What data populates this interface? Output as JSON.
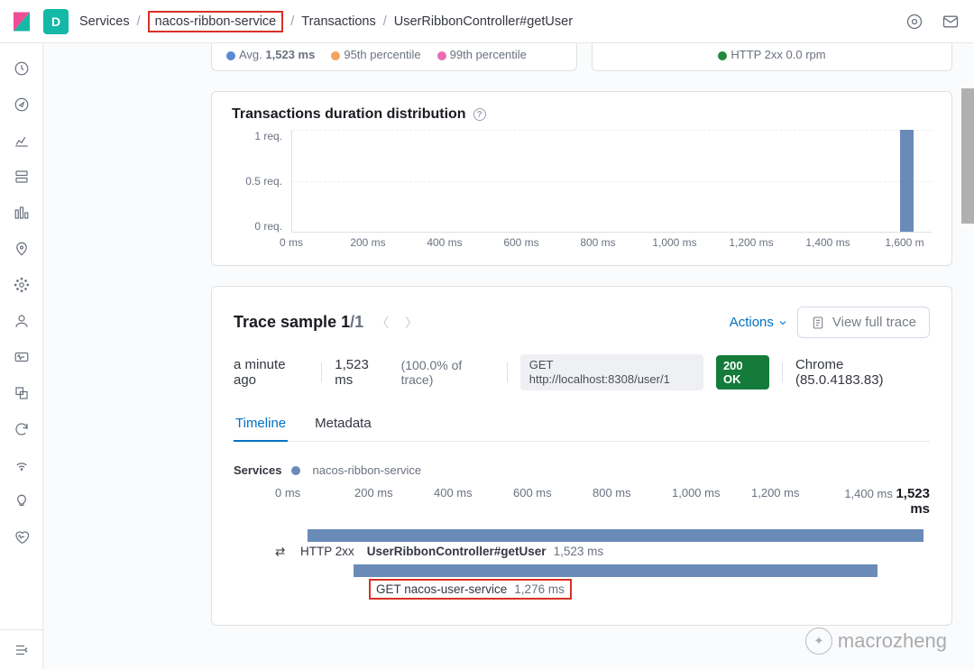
{
  "top": {
    "space_letter": "D",
    "crumbs": [
      "Services",
      "nacos-ribbon-service",
      "Transactions",
      "UserRibbonController#getUser"
    ]
  },
  "legend": {
    "avg_label": "Avg.",
    "avg_value": "1,523 ms",
    "p95": "95th percentile",
    "p99": "99th percentile",
    "http2xx": "HTTP 2xx",
    "http2xx_rate": "0.0 rpm"
  },
  "dist": {
    "title": "Transactions duration distribution",
    "y": [
      "1 req.",
      "0.5 req.",
      "0 req."
    ],
    "x": [
      "0 ms",
      "200 ms",
      "400 ms",
      "600 ms",
      "800 ms",
      "1,000 ms",
      "1,200 ms",
      "1,400 ms",
      "1,600 m"
    ]
  },
  "chart_data": {
    "type": "bar",
    "title": "Transactions duration distribution",
    "xlabel": "",
    "ylabel": "",
    "x_unit": "ms",
    "y_unit": "req.",
    "categories": [
      0,
      200,
      400,
      600,
      800,
      1000,
      1200,
      1400,
      1600
    ],
    "values_at": {
      "bucket_ms": 1523,
      "count": 1
    },
    "xlim": [
      0,
      1600
    ],
    "ylim": [
      0,
      1
    ]
  },
  "trace": {
    "title": "Trace sample",
    "index": "1",
    "total": "/1",
    "actions": "Actions",
    "view_full": "View full trace",
    "time_ago": "a minute ago",
    "duration": "1,523 ms",
    "percent": "(100.0% of trace)",
    "method": "GET",
    "url": "http://localhost:8308/user/1",
    "status": "200 OK",
    "ua": "Chrome (85.0.4183.83)",
    "tabs": {
      "timeline": "Timeline",
      "metadata": "Metadata"
    },
    "services_label": "Services",
    "service_name": "nacos-ribbon-service",
    "ticks": [
      "0 ms",
      "200 ms",
      "400 ms",
      "600 ms",
      "800 ms",
      "1,000 ms",
      "1,200 ms",
      "1,400 ms"
    ],
    "total_ms": "1,523 ms",
    "spans": [
      {
        "badge": "HTTP 2xx",
        "name": "UserRibbonController#getUser",
        "dur": "1,523 ms",
        "left": 5,
        "width": 94,
        "bold": true
      },
      {
        "badge": "",
        "name": "GET nacos-user-service",
        "dur": "1,276 ms",
        "left": 12,
        "width": 80,
        "bold": false,
        "red": true
      }
    ]
  },
  "watermark": "macrozheng"
}
